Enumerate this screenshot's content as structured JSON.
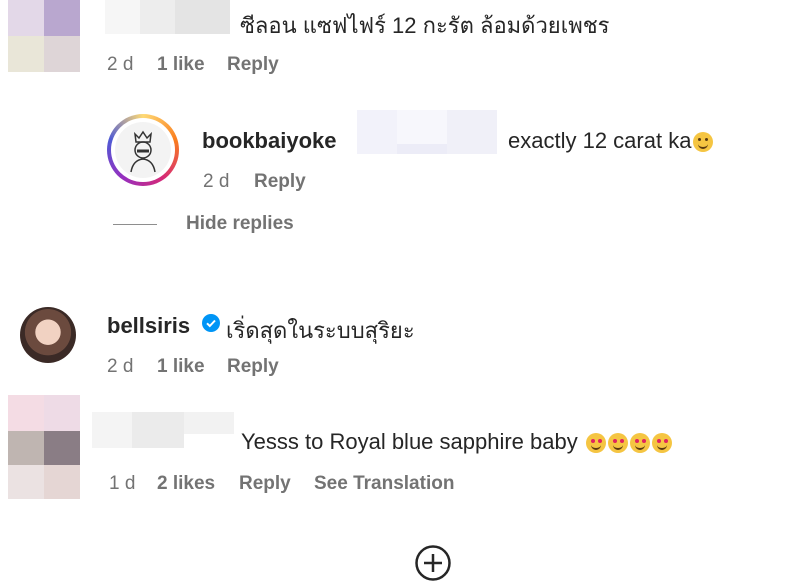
{
  "comment1": {
    "text": "ซีลอน แซฟไฟร์ 12 กะรัต ล้อมด้วยเพชร",
    "time": "2 d",
    "likes": "1 like",
    "reply": "Reply"
  },
  "reply1": {
    "username": "bookbaiyoke",
    "text": "exactly 12 carat ka",
    "time": "2 d",
    "reply": "Reply",
    "hide_replies": "Hide replies"
  },
  "comment2": {
    "username": "bellsiris",
    "text": "เริ่ดสุดในระบบสุริยะ",
    "time": "2 d",
    "likes": "1 like",
    "reply": "Reply",
    "verified_icon": "verified-badge-icon",
    "accent": "#0095f6"
  },
  "comment3": {
    "text": "Yesss to Royal blue sapphire baby",
    "time": "1 d",
    "likes": "2 likes",
    "reply": "Reply",
    "see_translation": "See Translation"
  },
  "load_more_icon": "plus-circle-icon"
}
